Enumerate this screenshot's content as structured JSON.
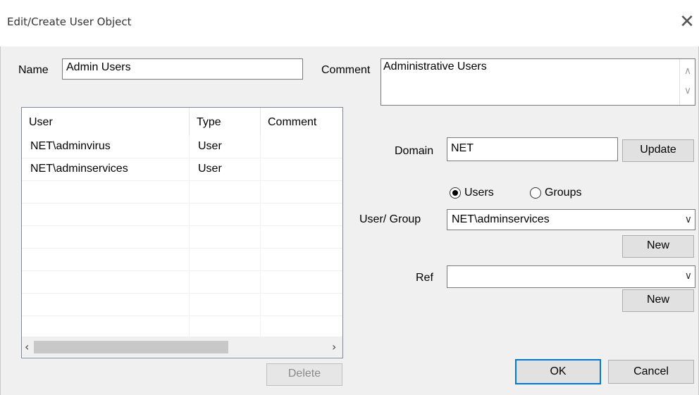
{
  "window": {
    "title": "Edit/Create User Object",
    "close_icon": "close-icon"
  },
  "form": {
    "name_label": "Name",
    "name_value": "Admin Users",
    "comment_label": "Comment",
    "comment_value": "Administrative Users"
  },
  "grid": {
    "columns": [
      "User",
      "Type",
      "Comment"
    ],
    "rows": [
      {
        "user": "NET\\adminvirus",
        "type": "User",
        "comment": ""
      },
      {
        "user": "NET\\adminservices",
        "type": "User",
        "comment": ""
      }
    ],
    "delete_label": "Delete"
  },
  "domain": {
    "label": "Domain",
    "value": "NET",
    "update_label": "Update"
  },
  "filter": {
    "users_label": "Users",
    "groups_label": "Groups",
    "selected": "Users"
  },
  "usergroup": {
    "label": "User/ Group",
    "value": "NET\\adminservices",
    "new_label": "New"
  },
  "ref": {
    "label": "Ref",
    "value": "",
    "new_label": "New"
  },
  "footer": {
    "ok_label": "OK",
    "cancel_label": "Cancel"
  },
  "colors": {
    "accent": "#0078d7",
    "dialog_bg": "#f0f0f0"
  }
}
